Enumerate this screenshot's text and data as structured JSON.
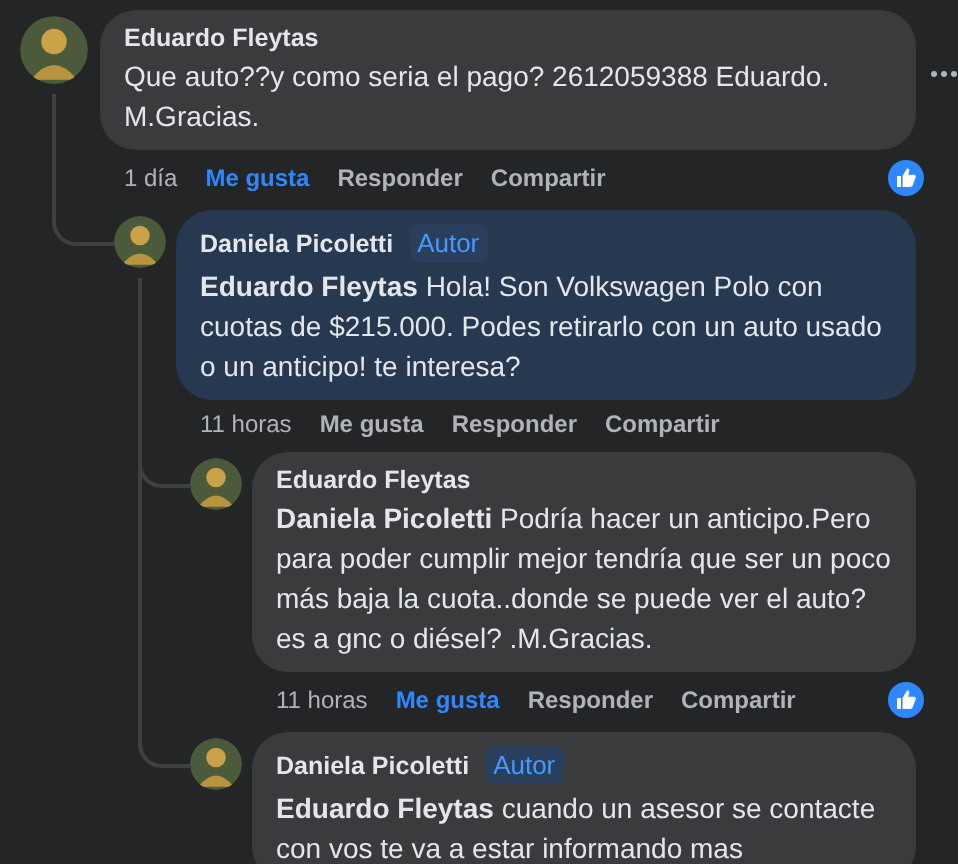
{
  "comments": [
    {
      "author": "Eduardo Fleytas",
      "highlighted": false,
      "more_menu": true,
      "text": "Que auto??y como seria el pago? 2612059388 Eduardo. M.Gracias.",
      "time": "1 día",
      "actions": [
        {
          "label": "Me gusta",
          "selected": true
        },
        {
          "label": "Responder",
          "selected": false
        },
        {
          "label": "Compartir",
          "selected": false
        }
      ],
      "reaction": true,
      "children": [
        {
          "author": "Daniela Picoletti",
          "badge": "Autor",
          "highlighted": true,
          "mention": "Eduardo Fleytas",
          "text": "Hola! Son Volkswagen Polo con cuotas de $215.000. Podes retirarlo con un auto usado o un anticipo! te interesa?",
          "time": "11 horas",
          "actions": [
            {
              "label": "Me gusta",
              "selected": false
            },
            {
              "label": "Responder",
              "selected": false
            },
            {
              "label": "Compartir",
              "selected": false
            }
          ],
          "children": [
            {
              "author": "Eduardo Fleytas",
              "highlighted": false,
              "mention": "Daniela Picoletti",
              "text": "Podría hacer un anticipo.Pero para poder cumplir mejor tendría que ser un poco más baja la cuota..donde se puede ver el auto?es a gnc o diésel? .M.Gracias.",
              "time": "11 horas",
              "actions": [
                {
                  "label": "Me gusta",
                  "selected": true
                },
                {
                  "label": "Responder",
                  "selected": false
                },
                {
                  "label": "Compartir",
                  "selected": false
                }
              ],
              "reaction": true
            },
            {
              "author": "Daniela Picoletti",
              "badge": "Autor",
              "highlighted": false,
              "mention": "Eduardo Fleytas",
              "text": "cuando un asesor se contacte con vos te va a estar informando mas"
            }
          ]
        }
      ]
    }
  ]
}
